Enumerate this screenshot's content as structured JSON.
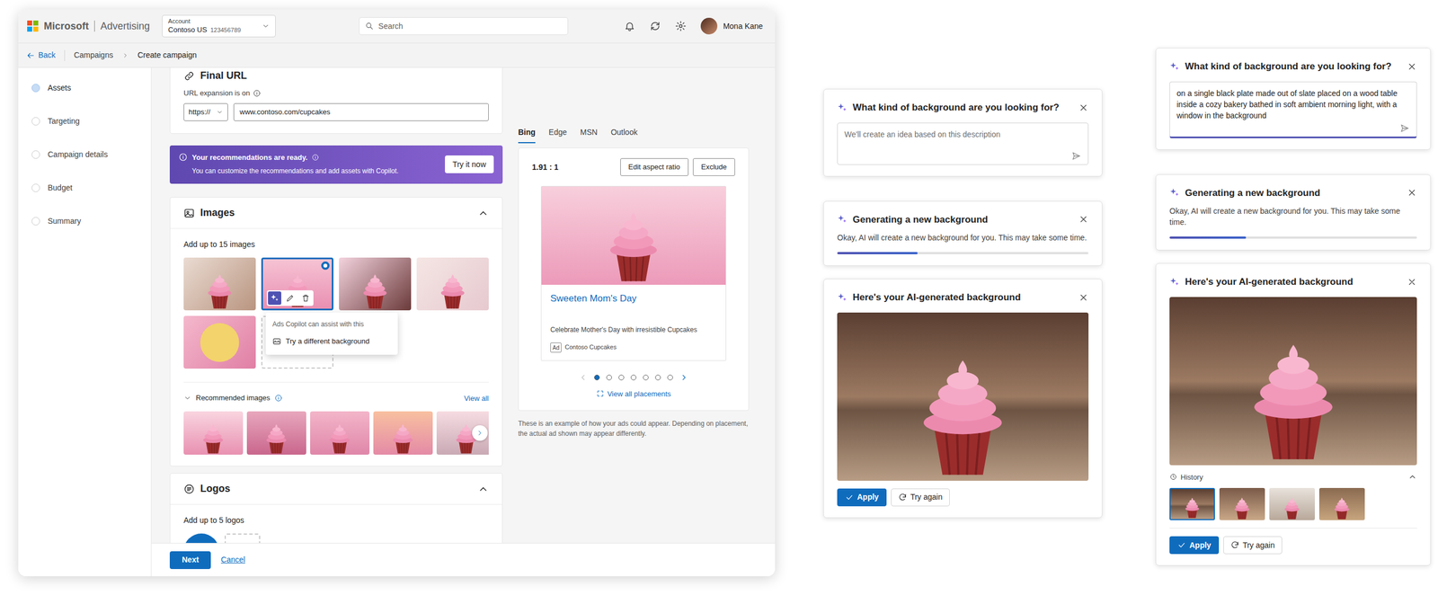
{
  "header": {
    "brand": "Microsoft",
    "product": "Advertising",
    "account": {
      "label": "Account",
      "name": "Contoso US",
      "id": "123456789"
    },
    "search": {
      "placeholder": "Search"
    },
    "user": "Mona Kane"
  },
  "breadcrumb": {
    "back": "Back",
    "items": [
      "Campaigns",
      "Create campaign"
    ]
  },
  "steps": [
    {
      "label": "Assets",
      "selected": true
    },
    {
      "label": "Targeting",
      "selected": false
    },
    {
      "label": "Campaign details",
      "selected": false
    },
    {
      "label": "Budget",
      "selected": false
    },
    {
      "label": "Summary",
      "selected": false
    }
  ],
  "final_url": {
    "title": "Final URL",
    "expansion_note": "URL expansion is on",
    "protocol": "https://",
    "url": "www.contoso.com/cupcakes"
  },
  "banner": {
    "title": "Your recommendations are ready.",
    "text": "You can customize the recommendations and add assets with Copilot.",
    "button": "Try it now"
  },
  "images": {
    "title": "Images",
    "hint": "Add up to 15 images",
    "items": [
      {
        "selected": false
      },
      {
        "selected": true
      },
      {
        "selected": false
      },
      {
        "selected": false
      },
      {
        "selected": false
      }
    ],
    "copilot_menu": {
      "title": "Ads Copilot can assist with this",
      "action": "Try a different background"
    },
    "recommended": {
      "title": "Recommended images",
      "view_all": "View all",
      "items": [
        {
          "selected": false
        },
        {
          "selected": false
        },
        {
          "selected": false
        },
        {
          "selected": false
        },
        {
          "selected": false
        }
      ]
    }
  },
  "logos": {
    "title": "Logos",
    "hint": "Add up to 5 logos"
  },
  "footer": {
    "next": "Next",
    "cancel": "Cancel"
  },
  "preview": {
    "tabs": [
      {
        "label": "Bing",
        "selected": true
      },
      {
        "label": "Edge",
        "selected": false
      },
      {
        "label": "MSN",
        "selected": false
      },
      {
        "label": "Outlook",
        "selected": false
      }
    ],
    "ratio": "1.91 : 1",
    "buttons": [
      "Edit aspect ratio",
      "Exclude"
    ],
    "ad": {
      "title": "Sweeten Mom's Day",
      "text": "Celebrate Mother's Day with irresistible Cupcakes",
      "badge": "Ad",
      "advertiser": "Contoso Cupcakes"
    },
    "pages": [
      {
        "selected": true
      },
      {
        "selected": false
      },
      {
        "selected": false
      },
      {
        "selected": false
      },
      {
        "selected": false
      },
      {
        "selected": false
      },
      {
        "selected": false
      }
    ],
    "view_all": "View all placements",
    "note": "These is an example of how your ads could appear. Depending on placement, the actual ad shown may appear differently."
  },
  "flows": [
    {
      "prompt": {
        "title": "What kind of background are you looking for?",
        "placeholder": "We'll create an idea based on this description"
      },
      "generating": {
        "title": "Generating a new background",
        "text": "Okay, AI will create a new background for you. This may take some time.",
        "level": 0.32
      },
      "result": {
        "title": "Here's your AI-generated background",
        "apply": "Apply",
        "try_again": "Try again"
      }
    },
    {
      "prompt": {
        "title": "What kind of background are you looking for?",
        "value": "on a single black plate made out of slate placed on a wood table inside a cozy bakery bathed in soft ambient morning light, with a window in the background"
      },
      "generating": {
        "title": "Generating a new background",
        "text": "Okay, AI will create a new background for you. This may take some time.",
        "level": 0.31
      },
      "result": {
        "title": "Here's your AI-generated background",
        "history": {
          "title": "History",
          "expanded": true,
          "items": [
            {
              "selected": true
            },
            {
              "selected": false
            },
            {
              "selected": false
            },
            {
              "selected": false
            }
          ]
        },
        "apply": "Apply",
        "try_again": "Try again"
      }
    }
  ]
}
